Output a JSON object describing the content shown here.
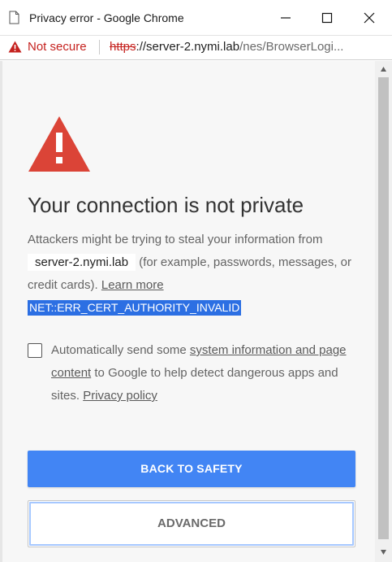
{
  "window": {
    "title": "Privacy error - Google Chrome",
    "minimize_icon": "minimize-icon",
    "maximize_icon": "maximize-icon",
    "close_icon": "close-icon"
  },
  "address_bar": {
    "security_label": "Not secure",
    "url_scheme": "https",
    "url_host": "://server-2.nymi.lab",
    "url_path": "/nes/BrowserLogi..."
  },
  "interstitial": {
    "heading": "Your connection is not private",
    "body_part1": "Attackers might be trying to steal your information from",
    "host": "server-2.nymi.lab",
    "body_part2": "(for example, passwords, messages, or credit cards).",
    "learn_more": "Learn more",
    "error_code": "NET::ERR_CERT_AUTHORITY_INVALID",
    "extended_prefix": "Automatically send some",
    "extended_link": "system information and page content",
    "extended_mid": "to Google to help detect dangerous apps and sites.",
    "privacy_policy": "Privacy policy",
    "checkbox_checked": false,
    "primary_button": "BACK TO SAFETY",
    "secondary_button": "ADVANCED"
  },
  "colors": {
    "primary": "#4285f4",
    "danger": "#db4437",
    "not_secure": "#c5221f",
    "error_code_bg": "#2c6fe3"
  }
}
